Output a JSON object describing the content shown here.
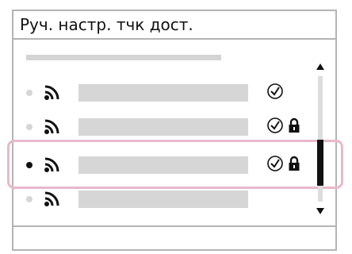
{
  "screen": {
    "title": "Руч. настр. тчк дост.",
    "colors": {
      "border": "#b4b4b4",
      "placeholder_bar": "#d6d6d6",
      "selection_frame": "#e8b8cc",
      "foreground": "#111111"
    }
  },
  "access_points": [
    {
      "selected": false,
      "icon": "wifi-icon",
      "status_icons": [
        "check-icon"
      ]
    },
    {
      "selected": false,
      "icon": "wifi-icon",
      "status_icons": [
        "check-icon",
        "lock-icon"
      ]
    },
    {
      "selected": true,
      "icon": "wifi-icon",
      "status_icons": [
        "check-icon",
        "lock-icon"
      ]
    },
    {
      "selected": false,
      "icon": "wifi-icon",
      "status_icons": []
    }
  ],
  "scroll": {
    "up_icon": "arrow-up-icon",
    "down_icon": "arrow-down-icon"
  }
}
